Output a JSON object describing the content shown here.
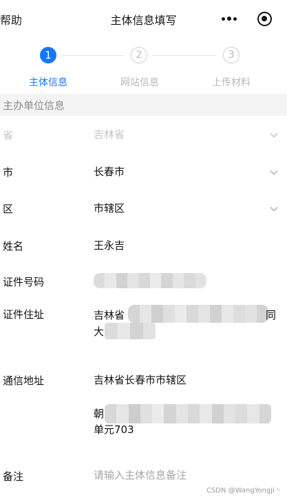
{
  "nav": {
    "help": "帮助",
    "title": "主体信息填写"
  },
  "steps": [
    {
      "num": "1",
      "label": "主体信息",
      "state": "active"
    },
    {
      "num": "2",
      "label": "网站信息",
      "state": "idle"
    },
    {
      "num": "3",
      "label": "上传材料",
      "state": "idle"
    }
  ],
  "section": {
    "title": "主办单位信息"
  },
  "fields": {
    "province": {
      "label": "省",
      "value": "吉林省"
    },
    "city": {
      "label": "市",
      "value": "长春市"
    },
    "district": {
      "label": "区",
      "value": "市辖区"
    },
    "name": {
      "label": "姓名",
      "value": "王永吉"
    },
    "id_number": {
      "label": "证件号码"
    },
    "id_address": {
      "label": "证件住址",
      "line1_prefix": "吉林省",
      "line1_suffix": "同",
      "line2_prefix": "大"
    },
    "mail_address": {
      "label": "通信地址",
      "line1": "吉林省长春市市辖区",
      "line2_prefix": "朝",
      "line3": "单元703"
    },
    "remark": {
      "label": "备注",
      "placeholder": "请输入主体信息备注"
    }
  },
  "watermark": "CSDN @WangYongJi丶",
  "colors": {
    "accent": "#1677ff",
    "disabled": "#c4c4c4",
    "section_bg": "#f4f4f4"
  },
  "icons": [
    "more-icon",
    "close-capsule-icon",
    "chevron-down-icon"
  ]
}
